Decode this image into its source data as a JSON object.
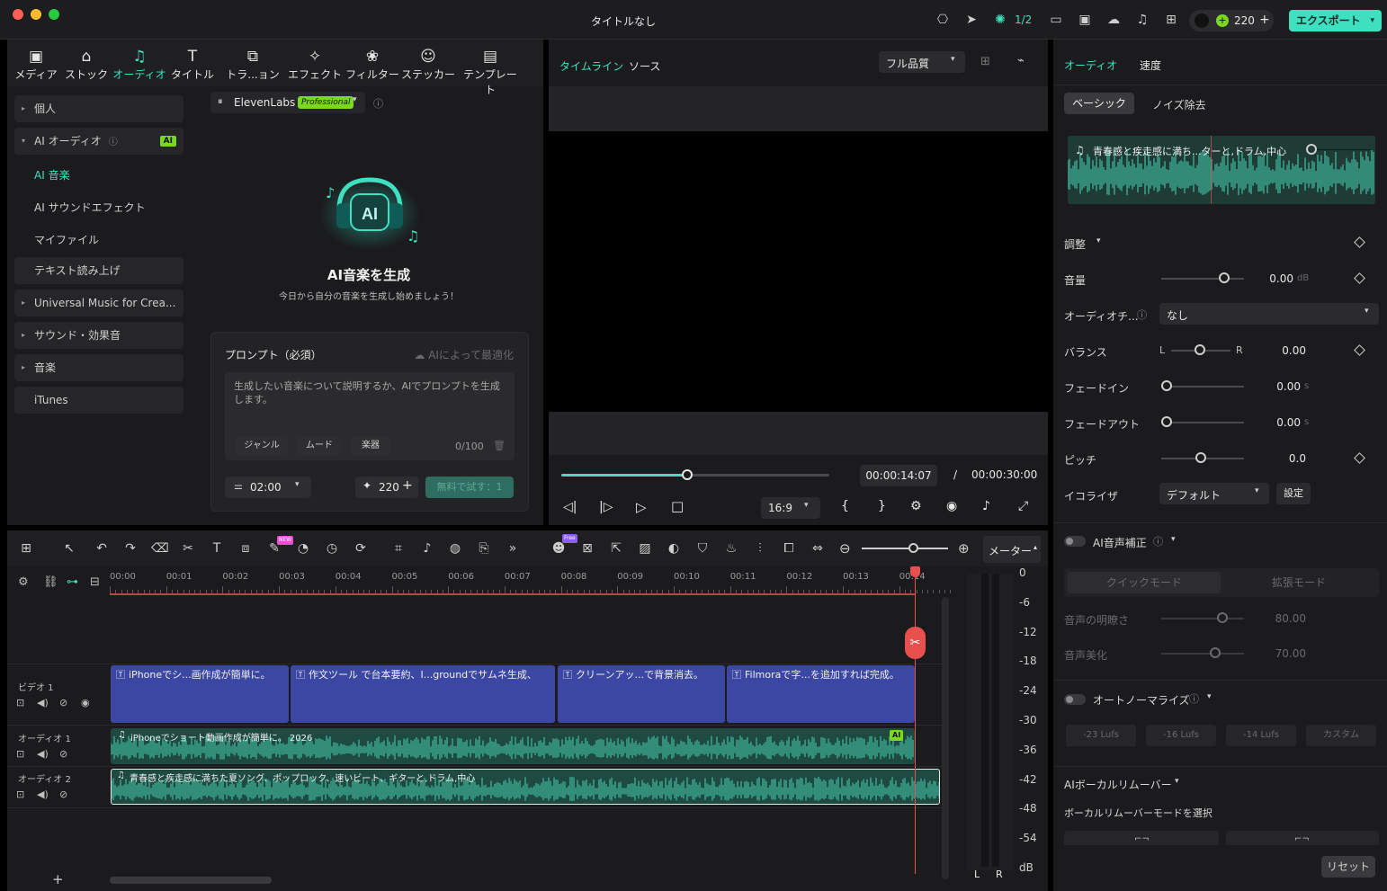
{
  "window": {
    "title": "タイトルなし",
    "progress": "1/2",
    "credits": "220",
    "export_label": "エクスポート"
  },
  "media_tabs": [
    {
      "label": "メディア",
      "icon": "media-icon"
    },
    {
      "label": "ストック",
      "icon": "stock-icon"
    },
    {
      "label": "オーディオ",
      "icon": "audio-icon",
      "active": true
    },
    {
      "label": "タイトル",
      "icon": "title-icon"
    },
    {
      "label": "トラ...ョン",
      "icon": "transition-icon"
    },
    {
      "label": "エフェクト",
      "icon": "effect-icon"
    },
    {
      "label": "フィルター",
      "icon": "filter-icon"
    },
    {
      "label": "ステッカー",
      "icon": "sticker-icon"
    },
    {
      "label": "テンプレート",
      "icon": "template-icon"
    }
  ],
  "sidebar": {
    "personal": "個人",
    "ai_audio": "AI オーディオ",
    "ai_badge": "AI",
    "sub_items": [
      "AI 音楽",
      "AI サウンドエフェクト",
      "マイファイル"
    ],
    "tts": "テキスト読み上げ",
    "universal": "Universal Music for Crea...",
    "sound_effects": "サウンド・効果音",
    "music": "音楽",
    "itunes": "iTunes"
  },
  "generator": {
    "provider": "ElevenLabs",
    "provider_badge": "Professional",
    "hero_title": "AI音楽を生成",
    "hero_subtitle": "今日から自分の音楽を生成し始めましょう！",
    "prompt_label": "プロンプト（必須）",
    "optimize_label": "AIによって最適化",
    "prompt_placeholder": "生成したい音楽について説明するか、AIでプロンプトを生成します。",
    "chips": [
      "ジャンル",
      "ムード",
      "楽器"
    ],
    "char_count": "0/100",
    "duration": "02:00",
    "cost": "220",
    "try_free": "無料で試す：1"
  },
  "preview": {
    "tab_timeline": "タイムライン",
    "tab_source": "ソース",
    "quality": "フル品質",
    "current_time": "00:00:14:07",
    "separator": "/",
    "total_time": "00:00:30:00",
    "aspect": "16:9",
    "progress_fraction": 0.47
  },
  "inspector": {
    "tab_audio": "オーディオ",
    "tab_speed": "速度",
    "sub_basic": "ベーシック",
    "sub_noise": "ノイズ除去",
    "clip_title": "青春感と疾走感に満ち...ターと,ドラム,中心",
    "adjust": "調整",
    "volume_label": "音量",
    "volume_value": "0.00",
    "volume_unit": "dB",
    "audio_ch_label": "オーディオチ...",
    "audio_ch_value": "なし",
    "balance_label": "バランス",
    "balance_l": "L",
    "balance_r": "R",
    "balance_value": "0.00",
    "fadein_label": "フェードイン",
    "fadein_value": "0.00",
    "fadein_unit": "s",
    "fadeout_label": "フェードアウト",
    "fadeout_value": "0.00",
    "fadeout_unit": "s",
    "pitch_label": "ピッチ",
    "pitch_value": "0.0",
    "eq_label": "イコライザ",
    "eq_value": "デフォルト",
    "eq_setting": "設定",
    "ai_voice": "AI音声補正",
    "quick_mode": "クイックモード",
    "ext_mode": "拡張モード",
    "clarity_label": "音声の明瞭さ",
    "clarity_value": "80.00",
    "beauty_label": "音声美化",
    "beauty_value": "70.00",
    "auto_norm": "オートノーマライズ",
    "lufs": [
      "-23 Lufs",
      "-16 Lufs",
      "-14 Lufs",
      "カスタム"
    ],
    "vocal_remover": "AIボーカルリムーバー",
    "vocal_mode": "ボーカルリムーバーモードを選択",
    "reset": "リセット"
  },
  "timeline": {
    "meter_label": "メーター",
    "ticks": [
      "00:00",
      "00:01",
      "00:02",
      "00:03",
      "00:04",
      "00:05",
      "00:06",
      "00:07",
      "00:08",
      "00:09",
      "00:10",
      "00:11",
      "00:12",
      "00:13",
      "00:14"
    ],
    "meter_scale": [
      "0",
      "-6",
      "-12",
      "-18",
      "-24",
      "-30",
      "-36",
      "-42",
      "-48",
      "-54",
      "dB"
    ],
    "meter_l": "L",
    "meter_r": "R",
    "track_video": "ビデオ 1",
    "track_audio1": "オーディオ 1",
    "track_audio2": "オーディオ 2",
    "video_clips": [
      "iPhoneでシ...画作成が簡単に。",
      "作文ツール で台本要約、I...groundでサムネ生成、",
      "クリーンアッ...で背景消去。",
      "Filmoraで字...を追加すれば完成。"
    ],
    "audio1_clip": "iPhoneでショート動画作成が簡単に。 2026",
    "audio1_badge": "AI",
    "audio2_clip": "青春感と疾走感に満ちた夏ソング、ポップロック、速いビート、ギターと,ドラム,中心",
    "new_badge": "NEW",
    "free_badge": "Free",
    "add": "+"
  },
  "colors": {
    "accent": "#3ee0c0",
    "video_clip": "#3b47a3",
    "audio_clip": "#1f5c4f",
    "playhead": "#e8504e"
  }
}
